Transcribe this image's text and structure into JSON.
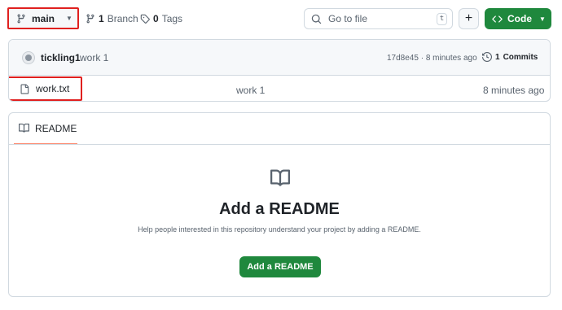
{
  "branch": {
    "name": "main"
  },
  "repo_stats": {
    "branches_count": "1",
    "branches_label": "Branch",
    "tags_count": "0",
    "tags_label": "Tags"
  },
  "search": {
    "placeholder": "Go to file",
    "shortcut": "t"
  },
  "actions": {
    "add_label": "+",
    "code_label": "Code"
  },
  "latest_commit": {
    "author": "tickling1",
    "message": "work 1",
    "sha_and_time": "17d8e45 · 8 minutes ago",
    "commits_count": "1",
    "commits_label": "Commits"
  },
  "files": [
    {
      "name": "work.txt",
      "commit_message": "work 1",
      "age": "8 minutes ago"
    }
  ],
  "readme": {
    "tab_label": "README",
    "title": "Add a README",
    "description": "Help people interested in this repository understand your project by adding a README.",
    "button_label": "Add a README"
  },
  "colors": {
    "primary_green": "#1f883d",
    "highlight_red": "#e0201f",
    "tab_underline": "#fd8c73"
  }
}
